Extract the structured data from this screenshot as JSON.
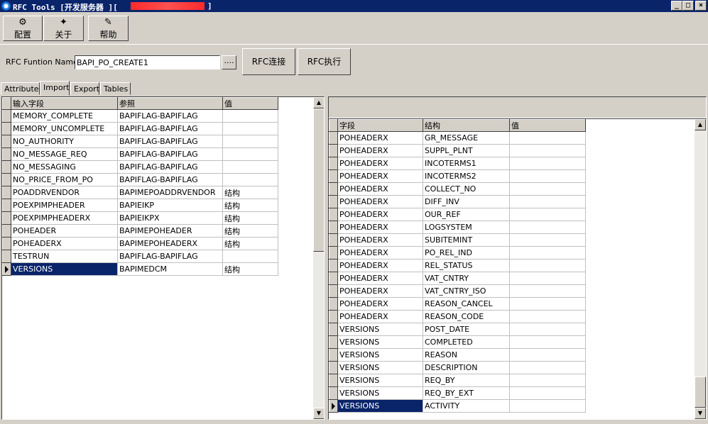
{
  "window": {
    "title": "RFC Tools [开发服务器 ][",
    "title_end": "]",
    "min": "_",
    "max": "□",
    "close": "×"
  },
  "toolbar": {
    "config_label": "配置",
    "about_label": "关于",
    "help_label": "帮助",
    "config_icon": "⚙",
    "about_icon": "✦",
    "help_icon": "✎"
  },
  "func": {
    "label": "RFC Funtion Name:",
    "value": "BAPI_PO_CREATE1",
    "browse": "....",
    "connect_label": "RFC连接",
    "execute_label": "RFC执行"
  },
  "tabs": [
    "Attributes",
    "Import",
    "Export",
    "Tables"
  ],
  "left_table": {
    "headers": [
      "输入字段",
      "参照",
      "值"
    ],
    "rows": [
      [
        "MEMORY_COMPLETE",
        "BAPIFLAG-BAPIFLAG",
        ""
      ],
      [
        "MEMORY_UNCOMPLETE",
        "BAPIFLAG-BAPIFLAG",
        ""
      ],
      [
        "NO_AUTHORITY",
        "BAPIFLAG-BAPIFLAG",
        ""
      ],
      [
        "NO_MESSAGE_REQ",
        "BAPIFLAG-BAPIFLAG",
        ""
      ],
      [
        "NO_MESSAGING",
        "BAPIFLAG-BAPIFLAG",
        ""
      ],
      [
        "NO_PRICE_FROM_PO",
        "BAPIFLAG-BAPIFLAG",
        ""
      ],
      [
        "POADDRVENDOR",
        "BAPIMEPOADDRVENDOR",
        "结构"
      ],
      [
        "POEXPIMPHEADER",
        "BAPIEIKP",
        "结构"
      ],
      [
        "POEXPIMPHEADERX",
        "BAPIEIKPX",
        "结构"
      ],
      [
        "POHEADER",
        "BAPIMEPOHEADER",
        "结构"
      ],
      [
        "POHEADERX",
        "BAPIMEPOHEADERX",
        "结构"
      ],
      [
        "TESTRUN",
        "BAPIFLAG-BAPIFLAG",
        ""
      ],
      [
        "VERSIONS",
        "BAPIMEDCM",
        "结构"
      ]
    ]
  },
  "right_table": {
    "headers": [
      "字段",
      "结构",
      "值"
    ],
    "rows": [
      [
        "POHEADERX",
        "GR_MESSAGE",
        ""
      ],
      [
        "POHEADERX",
        "SUPPL_PLNT",
        ""
      ],
      [
        "POHEADERX",
        "INCOTERMS1",
        ""
      ],
      [
        "POHEADERX",
        "INCOTERMS2",
        ""
      ],
      [
        "POHEADERX",
        "COLLECT_NO",
        ""
      ],
      [
        "POHEADERX",
        "DIFF_INV",
        ""
      ],
      [
        "POHEADERX",
        "OUR_REF",
        ""
      ],
      [
        "POHEADERX",
        "LOGSYSTEM",
        ""
      ],
      [
        "POHEADERX",
        "SUBITEMINT",
        ""
      ],
      [
        "POHEADERX",
        "PO_REL_IND",
        ""
      ],
      [
        "POHEADERX",
        "REL_STATUS",
        ""
      ],
      [
        "POHEADERX",
        "VAT_CNTRY",
        ""
      ],
      [
        "POHEADERX",
        "VAT_CNTRY_ISO",
        ""
      ],
      [
        "POHEADERX",
        "REASON_CANCEL",
        ""
      ],
      [
        "POHEADERX",
        "REASON_CODE",
        ""
      ],
      [
        "VERSIONS",
        "POST_DATE",
        ""
      ],
      [
        "VERSIONS",
        "COMPLETED",
        ""
      ],
      [
        "VERSIONS",
        "REASON",
        ""
      ],
      [
        "VERSIONS",
        "DESCRIPTION",
        ""
      ],
      [
        "VERSIONS",
        "REQ_BY",
        ""
      ],
      [
        "VERSIONS",
        "REQ_BY_EXT",
        ""
      ],
      [
        "VERSIONS",
        "ACTIVITY",
        ""
      ]
    ]
  },
  "scroll": {
    "up": "▲",
    "down": "▼"
  }
}
